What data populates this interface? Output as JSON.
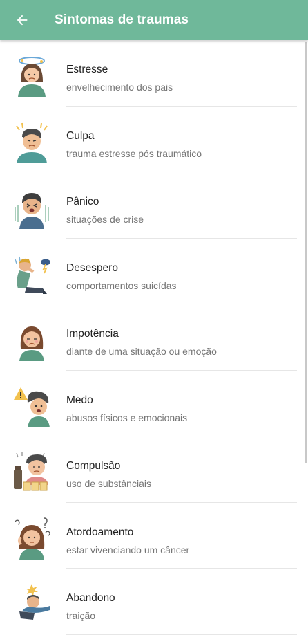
{
  "header": {
    "title": "Sintomas de traumas",
    "back_icon": "arrow-left-icon",
    "bg_color": "#6fb89a"
  },
  "items": [
    {
      "title": "Estresse",
      "subtitle": "envelhecimento dos pais",
      "icon": "stressed-woman-icon"
    },
    {
      "title": "Culpa",
      "subtitle": "trauma estresse pós traumático",
      "icon": "guilty-man-icon"
    },
    {
      "title": "Pânico",
      "subtitle": "situações de crise",
      "icon": "panicked-man-icon"
    },
    {
      "title": "Desespero",
      "subtitle": "comportamentos suicídas",
      "icon": "despairing-person-icon"
    },
    {
      "title": "Impotência",
      "subtitle": "diante de uma situação ou emoção",
      "icon": "sad-woman-icon"
    },
    {
      "title": "Medo",
      "subtitle": "abusos físicos e emocionais",
      "icon": "scared-boy-icon"
    },
    {
      "title": "Compulsão",
      "subtitle": "uso de substânciais",
      "icon": "compulsive-drinker-icon"
    },
    {
      "title": "Atordoamento",
      "subtitle": "estar vivenciando um câncer",
      "icon": "dazed-woman-icon"
    },
    {
      "title": "Abandono",
      "subtitle": "traição",
      "icon": "abandoned-man-icon"
    }
  ]
}
